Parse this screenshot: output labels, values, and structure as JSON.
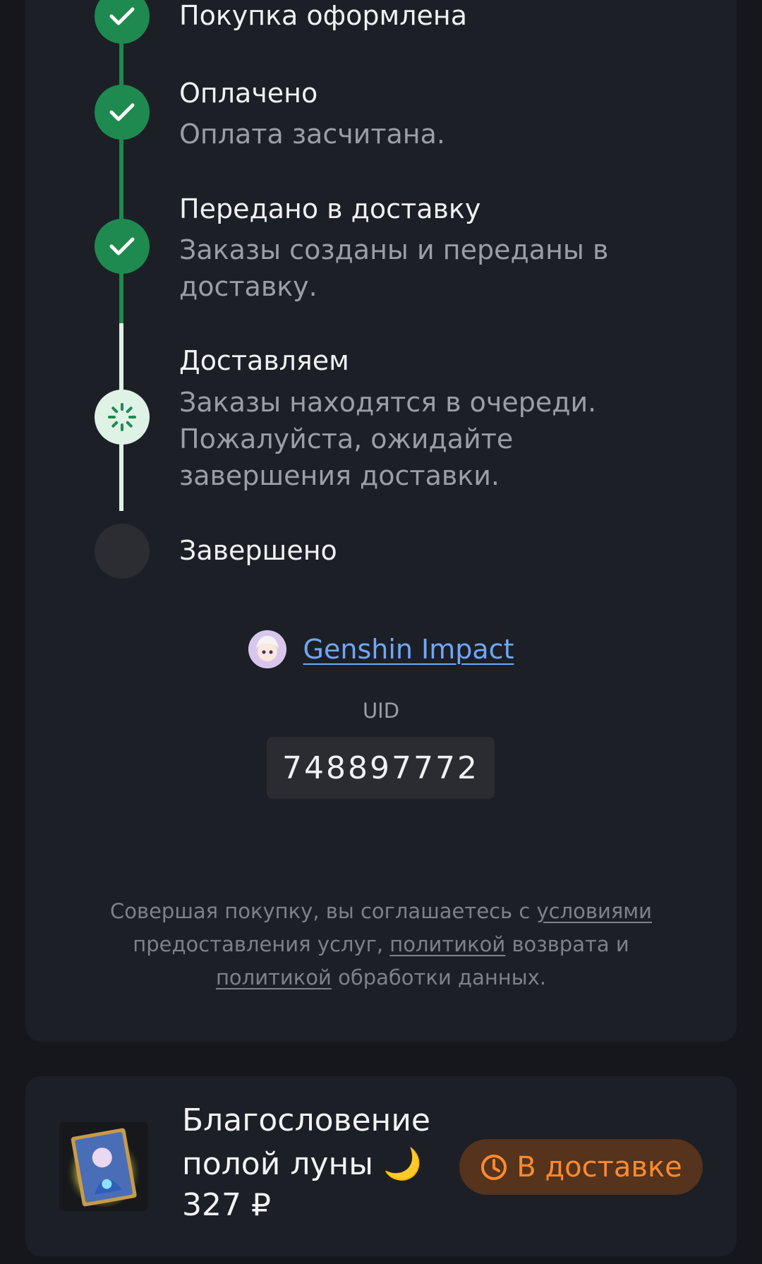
{
  "steps": [
    {
      "title": "Покупка оформлена",
      "description": "",
      "status": "done"
    },
    {
      "title": "Оплачено",
      "description": "Оплата засчитана.",
      "status": "done"
    },
    {
      "title": "Передано в доставку",
      "description": "Заказы созданы и переданы в доставку.",
      "status": "done"
    },
    {
      "title": "Доставляем",
      "description": "Заказы находятся в очереди. Пожалуйста, ожидайте завершения доставки.",
      "status": "in-progress"
    },
    {
      "title": "Завершено",
      "description": "",
      "status": "pending"
    }
  ],
  "game": {
    "name": "Genshin Impact",
    "icon": "game-avatar-icon"
  },
  "uid": {
    "label": "UID",
    "value": "748897772"
  },
  "terms": {
    "part1": "Совершая покупку, вы соглашаетесь с ",
    "link1": "условиями",
    "part2": " предоставления услуг, ",
    "link2": "политикой",
    "part3": " возврата и ",
    "link3": "политикой",
    "part4": " обработки данных."
  },
  "product": {
    "name": "Благословение полой луны 🌙",
    "price": "327 ₽",
    "status_label": "В доставке",
    "status_icon": "clock-icon"
  },
  "colors": {
    "done": "#1e8a4f",
    "pending": "#dff2e6",
    "link": "#6ea8f7",
    "badge_text": "#ff8a2e",
    "badge_bg": "#55331c"
  }
}
